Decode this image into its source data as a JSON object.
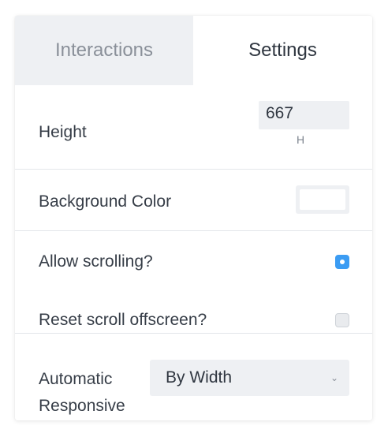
{
  "tabs": [
    {
      "label": "Interactions",
      "active": false
    },
    {
      "label": "Settings",
      "active": true
    }
  ],
  "height": {
    "label": "Height",
    "value": "667",
    "unit": "H"
  },
  "background_color": {
    "label": "Background Color",
    "value": "#ffffff"
  },
  "allow_scrolling": {
    "label": "Allow scrolling?",
    "checked": true
  },
  "reset_scroll": {
    "label": "Reset scroll offscreen?",
    "checked": false
  },
  "responsive": {
    "label_line1": "Automatic",
    "label_line2": "Responsive",
    "selected": "By Width",
    "chevron_icon": "chevron-down-icon"
  },
  "colors": {
    "accent": "#3b9cf3",
    "tab_inactive_bg": "#eef0f3",
    "divider": "#e3e6ea"
  }
}
